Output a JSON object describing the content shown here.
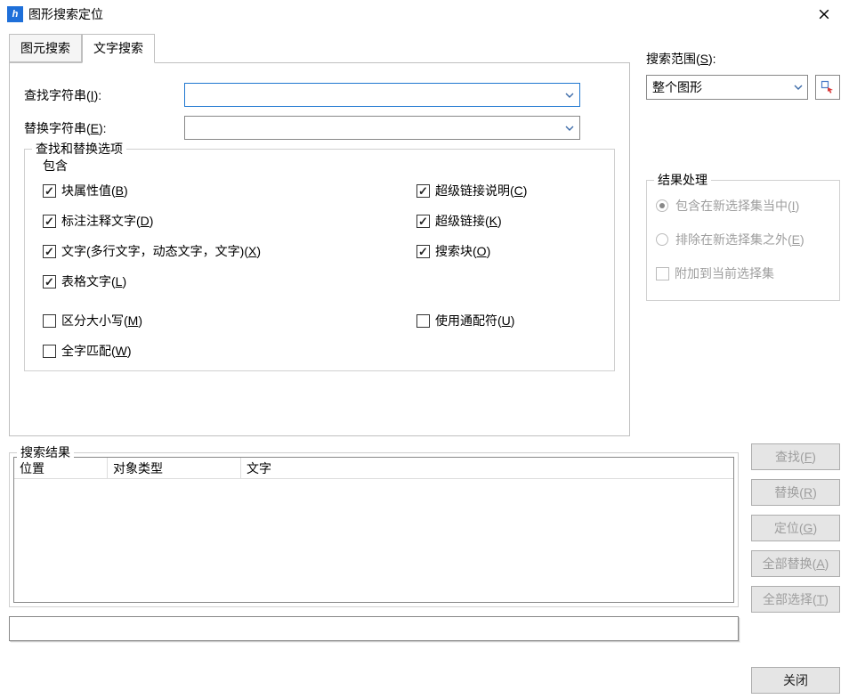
{
  "window": {
    "title": "图形搜索定位"
  },
  "tabs": {
    "primitive": "图元搜索",
    "text": "文字搜索"
  },
  "form": {
    "find_label_pre": "查找字符串(",
    "find_hot": "I",
    "find_label_post": "):",
    "replace_label_pre": "替换字符串(",
    "replace_hot": "E",
    "replace_label_post": "):",
    "find_value": "",
    "replace_value": ""
  },
  "options": {
    "legend": "查找和替换选项",
    "include": "包含",
    "block_attr_pre": "块属性值(",
    "block_attr_hot": "B",
    "block_attr_post": ")",
    "annot_pre": "标注注释文字(",
    "annot_hot": "D",
    "annot_post": ")",
    "mtext_pre": "文字(多行文字，动态文字，文字)(",
    "mtext_hot": "X",
    "mtext_post": ")",
    "table_pre": "表格文字(",
    "table_hot": "L",
    "table_post": ")",
    "hyperdesc_pre": "超级链接说明(",
    "hyperdesc_hot": "C",
    "hyperdesc_post": ")",
    "hyperlink_pre": "超级链接(",
    "hyperlink_hot": "K",
    "hyperlink_post": ")",
    "searchblock_pre": "搜索块(",
    "searchblock_hot": "O",
    "searchblock_post": ")",
    "case_pre": "区分大小写(",
    "case_hot": "M",
    "case_post": ")",
    "whole_pre": "全字匹配(",
    "whole_hot": "W",
    "whole_post": ")",
    "wildcard_pre": "使用通配符(",
    "wildcard_hot": "U",
    "wildcard_post": ")"
  },
  "scope": {
    "label_pre": "搜索范围(",
    "label_hot": "S",
    "label_post": "):",
    "value": "整个图形"
  },
  "result_handling": {
    "legend": "结果处理",
    "include_pre": "包含在新选择集当中(",
    "include_hot": "I",
    "include_post": ")",
    "exclude_pre": "排除在新选择集之外(",
    "exclude_hot": "E",
    "exclude_post": ")",
    "append": "附加到当前选择集"
  },
  "results": {
    "legend": "搜索结果",
    "col_pos": "位置",
    "col_type": "对象类型",
    "col_text": "文字"
  },
  "buttons": {
    "find_pre": "查找(",
    "find_hot": "F",
    "find_post": ")",
    "replace_pre": "替换(",
    "replace_hot": "R",
    "replace_post": ")",
    "locate_pre": "定位(",
    "locate_hot": "G",
    "locate_post": ")",
    "replace_all_pre": "全部替换(",
    "replace_all_hot": "A",
    "replace_all_post": ")",
    "select_all_pre": "全部选择(",
    "select_all_hot": "T",
    "select_all_post": ")",
    "close": "关闭"
  }
}
